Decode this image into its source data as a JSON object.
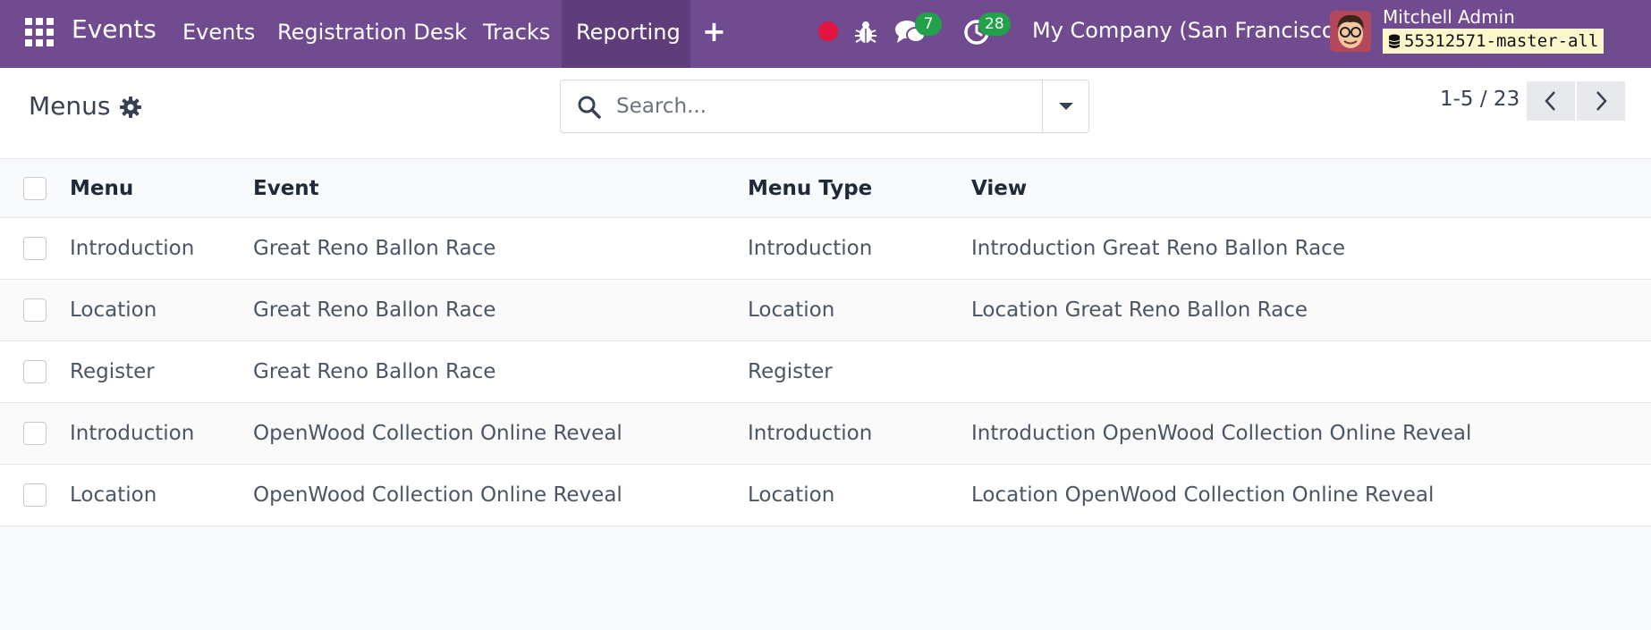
{
  "navbar": {
    "brand": "Events",
    "menu": [
      "Events",
      "Registration Desk",
      "Tracks",
      "Reporting"
    ],
    "active_menu": "Reporting",
    "messages_count": "7",
    "activities_count": "28",
    "company": "My Company (San Francisco)",
    "user_name": "Mitchell Admin",
    "database": "55312571-master-all"
  },
  "control_panel": {
    "title": "Menus",
    "search_placeholder": "Search...",
    "pager": "1-5 / 23"
  },
  "table": {
    "columns": [
      "Menu",
      "Event",
      "Menu Type",
      "View"
    ],
    "rows": [
      {
        "menu": "Introduction",
        "event": "Great Reno Ballon Race",
        "menu_type": "Introduction",
        "view": "Introduction Great Reno Ballon Race"
      },
      {
        "menu": "Location",
        "event": "Great Reno Ballon Race",
        "menu_type": "Location",
        "view": "Location Great Reno Ballon Race"
      },
      {
        "menu": "Register",
        "event": "Great Reno Ballon Race",
        "menu_type": "Register",
        "view": ""
      },
      {
        "menu": "Introduction",
        "event": "OpenWood Collection Online Reveal",
        "menu_type": "Introduction",
        "view": "Introduction OpenWood Collection Online Reveal"
      },
      {
        "menu": "Location",
        "event": "OpenWood Collection Online Reveal",
        "menu_type": "Location",
        "view": "Location OpenWood Collection Online Reveal"
      }
    ]
  },
  "colors": {
    "navbar": "#714b8f",
    "navbar_active": "#5f3d7a",
    "badge": "#21a24a",
    "record_dot": "#e5133f"
  },
  "icons": [
    "apps-grid-icon",
    "plus-icon",
    "record-icon",
    "bug-icon",
    "chat-icon",
    "clock-icon",
    "avatar",
    "database-icon",
    "gear-icon",
    "search-icon",
    "caret-down-icon",
    "chevron-left-icon",
    "chevron-right-icon"
  ]
}
